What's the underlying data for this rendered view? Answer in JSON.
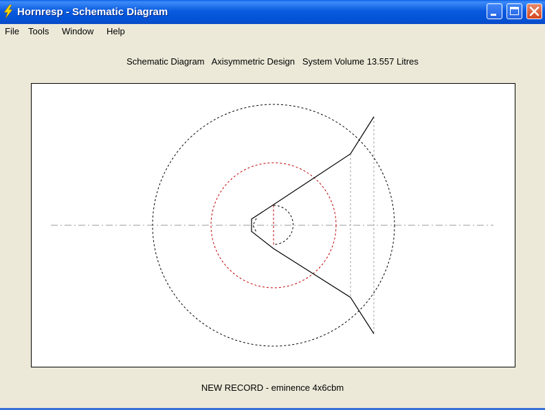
{
  "window": {
    "title": "Hornresp - Schematic Diagram",
    "icon": "lightning-icon",
    "controls": [
      "minimize-icon",
      "maximize-icon",
      "close-icon"
    ]
  },
  "menu": {
    "items": [
      "File",
      "Tools",
      "Window",
      "Help"
    ]
  },
  "header": {
    "text": "Schematic Diagram   Axisymmetric Design   System Volume 13.557 Litres"
  },
  "footer": {
    "text": "NEW RECORD - eminence 4x6cbm"
  },
  "diagram": {
    "colors": {
      "outline": "#000000",
      "inner_circle": "#c00000",
      "axis": "#9a9a9a",
      "guides": "#a0a0a0"
    }
  }
}
